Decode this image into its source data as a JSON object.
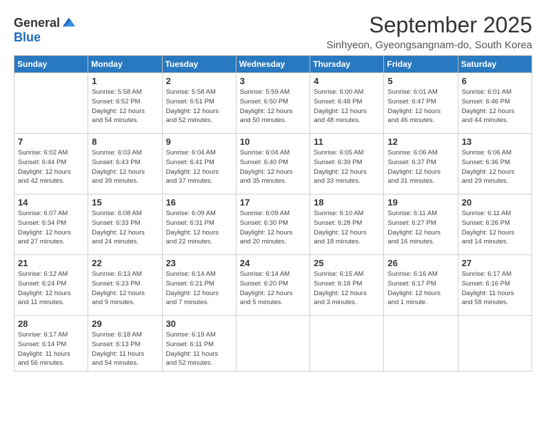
{
  "logo": {
    "general": "General",
    "blue": "Blue"
  },
  "title": "September 2025",
  "location": "Sinhyeon, Gyeongsangnam-do, South Korea",
  "days_of_week": [
    "Sunday",
    "Monday",
    "Tuesday",
    "Wednesday",
    "Thursday",
    "Friday",
    "Saturday"
  ],
  "weeks": [
    [
      {
        "day": "",
        "info": ""
      },
      {
        "day": "1",
        "info": "Sunrise: 5:58 AM\nSunset: 6:52 PM\nDaylight: 12 hours\nand 54 minutes."
      },
      {
        "day": "2",
        "info": "Sunrise: 5:58 AM\nSunset: 6:51 PM\nDaylight: 12 hours\nand 52 minutes."
      },
      {
        "day": "3",
        "info": "Sunrise: 5:59 AM\nSunset: 6:50 PM\nDaylight: 12 hours\nand 50 minutes."
      },
      {
        "day": "4",
        "info": "Sunrise: 6:00 AM\nSunset: 6:48 PM\nDaylight: 12 hours\nand 48 minutes."
      },
      {
        "day": "5",
        "info": "Sunrise: 6:01 AM\nSunset: 6:47 PM\nDaylight: 12 hours\nand 46 minutes."
      },
      {
        "day": "6",
        "info": "Sunrise: 6:01 AM\nSunset: 6:46 PM\nDaylight: 12 hours\nand 44 minutes."
      }
    ],
    [
      {
        "day": "7",
        "info": "Sunrise: 6:02 AM\nSunset: 6:44 PM\nDaylight: 12 hours\nand 42 minutes."
      },
      {
        "day": "8",
        "info": "Sunrise: 6:03 AM\nSunset: 6:43 PM\nDaylight: 12 hours\nand 39 minutes."
      },
      {
        "day": "9",
        "info": "Sunrise: 6:04 AM\nSunset: 6:41 PM\nDaylight: 12 hours\nand 37 minutes."
      },
      {
        "day": "10",
        "info": "Sunrise: 6:04 AM\nSunset: 6:40 PM\nDaylight: 12 hours\nand 35 minutes."
      },
      {
        "day": "11",
        "info": "Sunrise: 6:05 AM\nSunset: 6:39 PM\nDaylight: 12 hours\nand 33 minutes."
      },
      {
        "day": "12",
        "info": "Sunrise: 6:06 AM\nSunset: 6:37 PM\nDaylight: 12 hours\nand 31 minutes."
      },
      {
        "day": "13",
        "info": "Sunrise: 6:06 AM\nSunset: 6:36 PM\nDaylight: 12 hours\nand 29 minutes."
      }
    ],
    [
      {
        "day": "14",
        "info": "Sunrise: 6:07 AM\nSunset: 6:34 PM\nDaylight: 12 hours\nand 27 minutes."
      },
      {
        "day": "15",
        "info": "Sunrise: 6:08 AM\nSunset: 6:33 PM\nDaylight: 12 hours\nand 24 minutes."
      },
      {
        "day": "16",
        "info": "Sunrise: 6:09 AM\nSunset: 6:31 PM\nDaylight: 12 hours\nand 22 minutes."
      },
      {
        "day": "17",
        "info": "Sunrise: 6:09 AM\nSunset: 6:30 PM\nDaylight: 12 hours\nand 20 minutes."
      },
      {
        "day": "18",
        "info": "Sunrise: 6:10 AM\nSunset: 6:28 PM\nDaylight: 12 hours\nand 18 minutes."
      },
      {
        "day": "19",
        "info": "Sunrise: 6:11 AM\nSunset: 6:27 PM\nDaylight: 12 hours\nand 16 minutes."
      },
      {
        "day": "20",
        "info": "Sunrise: 6:11 AM\nSunset: 6:26 PM\nDaylight: 12 hours\nand 14 minutes."
      }
    ],
    [
      {
        "day": "21",
        "info": "Sunrise: 6:12 AM\nSunset: 6:24 PM\nDaylight: 12 hours\nand 11 minutes."
      },
      {
        "day": "22",
        "info": "Sunrise: 6:13 AM\nSunset: 6:23 PM\nDaylight: 12 hours\nand 9 minutes."
      },
      {
        "day": "23",
        "info": "Sunrise: 6:14 AM\nSunset: 6:21 PM\nDaylight: 12 hours\nand 7 minutes."
      },
      {
        "day": "24",
        "info": "Sunrise: 6:14 AM\nSunset: 6:20 PM\nDaylight: 12 hours\nand 5 minutes."
      },
      {
        "day": "25",
        "info": "Sunrise: 6:15 AM\nSunset: 6:18 PM\nDaylight: 12 hours\nand 3 minutes."
      },
      {
        "day": "26",
        "info": "Sunrise: 6:16 AM\nSunset: 6:17 PM\nDaylight: 12 hours\nand 1 minute."
      },
      {
        "day": "27",
        "info": "Sunrise: 6:17 AM\nSunset: 6:16 PM\nDaylight: 11 hours\nand 58 minutes."
      }
    ],
    [
      {
        "day": "28",
        "info": "Sunrise: 6:17 AM\nSunset: 6:14 PM\nDaylight: 11 hours\nand 56 minutes."
      },
      {
        "day": "29",
        "info": "Sunrise: 6:18 AM\nSunset: 6:13 PM\nDaylight: 11 hours\nand 54 minutes."
      },
      {
        "day": "30",
        "info": "Sunrise: 6:19 AM\nSunset: 6:11 PM\nDaylight: 11 hours\nand 52 minutes."
      },
      {
        "day": "",
        "info": ""
      },
      {
        "day": "",
        "info": ""
      },
      {
        "day": "",
        "info": ""
      },
      {
        "day": "",
        "info": ""
      }
    ]
  ]
}
